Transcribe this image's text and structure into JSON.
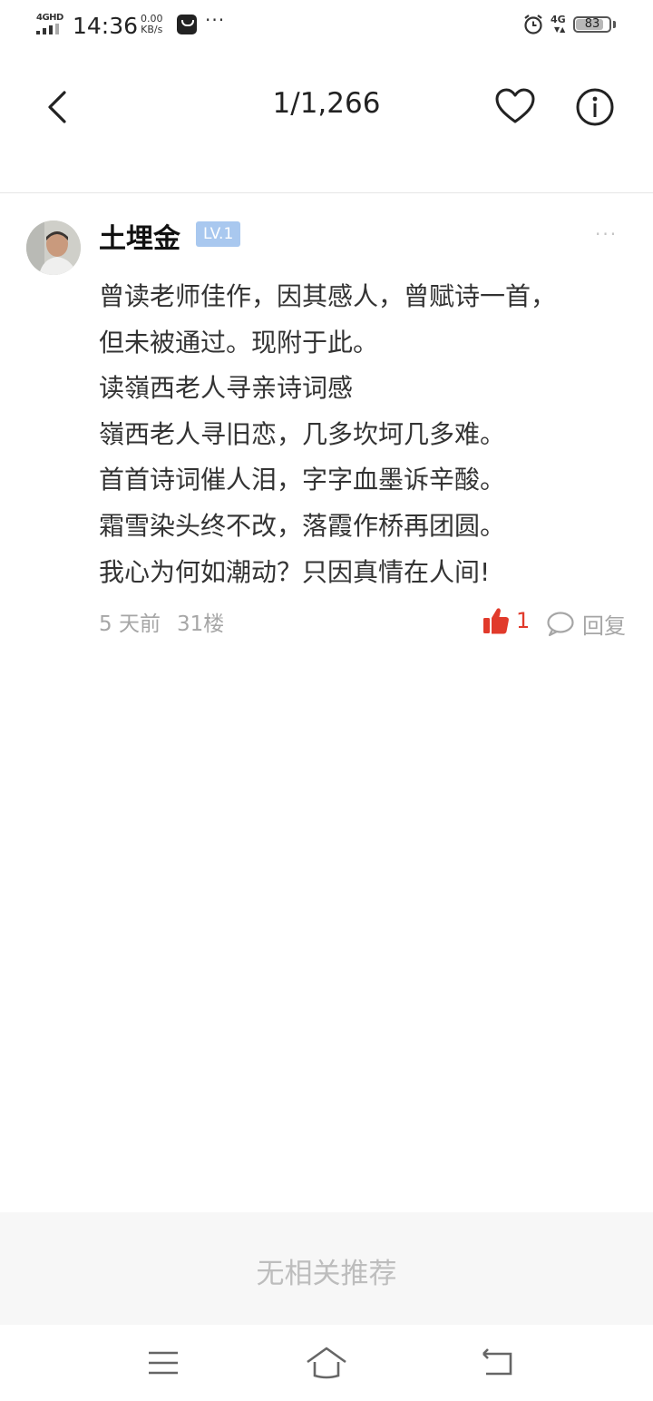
{
  "status_bar": {
    "network": "4GHD",
    "time": "14:36",
    "speed_value": "0.00",
    "speed_unit": "KB/s",
    "more": "···",
    "cell": "4G",
    "battery": "83",
    "battery_level": 0.83
  },
  "nav": {
    "title": "1/1,266",
    "back_icon": "chevron-left-icon",
    "favorite_icon": "heart-outline-icon",
    "info_icon": "info-circle-icon"
  },
  "post": {
    "username": "土埋金",
    "level": "LV.1",
    "more": "···",
    "lines": [
      "曾读老师佳作，因其感人，曾赋诗一首，",
      "但未被通过。现附于此。",
      "读嶺西老人寻亲诗词感",
      "嶺西老人寻旧恋，几多坎坷几多难。",
      "首首诗词催人泪，字字血墨诉辛酸。",
      "霜雪染头终不改，落霞作桥再团圆。",
      "我心为何如潮动？只因真情在人间!"
    ],
    "time": "5 天前",
    "floor": "31楼",
    "like_count": "1",
    "reply_label": "回复"
  },
  "footer": {
    "no_recommendation": "无相关推荐"
  },
  "colors": {
    "like": "#e13a2b",
    "level_badge": "#a9c8ef",
    "muted": "#a6a6a6"
  }
}
